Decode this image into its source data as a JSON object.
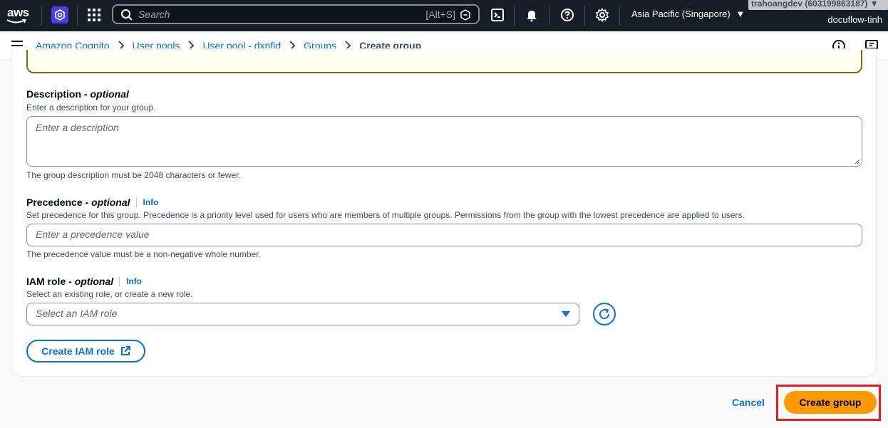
{
  "topnav": {
    "logo_text": "aws",
    "search_placeholder": "Search",
    "search_shortcut": "[Alt+S]",
    "region": "Asia Pacific (Singapore)",
    "account": "trahoangdev (603199863187)",
    "account_sub": "docuflow-tinh"
  },
  "breadcrumb": {
    "items": [
      "Amazon Cognito",
      "User pools",
      "User pool - dxnfid",
      "Groups"
    ],
    "current": "Create group"
  },
  "form": {
    "description": {
      "label": "Description",
      "optional": "optional",
      "hint": "Enter a description for your group.",
      "placeholder": "Enter a description",
      "constraint": "The group description must be 2048 characters or fewer."
    },
    "precedence": {
      "label": "Precedence",
      "optional": "optional",
      "info": "Info",
      "hint": "Set precedence for this group. Precedence is a priority level used for users who are members of multiple groups. Permissions from the group with the lowest precedence are applied to users.",
      "placeholder": "Enter a precedence value",
      "constraint": "The precedence value must be a non-negative whole number."
    },
    "iam_role": {
      "label": "IAM role",
      "optional": "optional",
      "info": "Info",
      "hint": "Select an existing role, or create a new role.",
      "placeholder": "Select an IAM role",
      "create_button": "Create IAM role"
    }
  },
  "actions": {
    "cancel": "Cancel",
    "submit": "Create group"
  },
  "colors": {
    "nav_bg": "#161d26",
    "link": "#0972d3",
    "primary": "#ff9900",
    "highlight": "#e01f1f"
  }
}
